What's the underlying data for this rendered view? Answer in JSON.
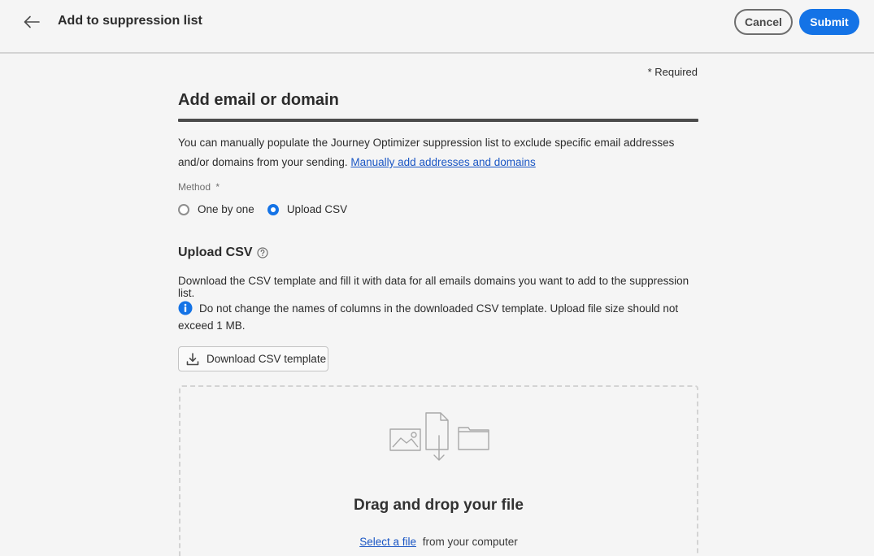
{
  "header": {
    "title": "Add to suppression list",
    "cancel_label": "Cancel",
    "submit_label": "Submit"
  },
  "form": {
    "required_note": "* Required",
    "section_title": "Add email or domain",
    "intro_text": "You can manually populate the Journey Optimizer suppression list to exclude specific email addresses and/or domains from your sending.",
    "intro_link": "Manually add addresses and domains",
    "method_label": "Method",
    "method_required_mark": "*",
    "method_options": [
      {
        "label": "One by one",
        "checked": false
      },
      {
        "label": "Upload CSV",
        "checked": true
      }
    ]
  },
  "upload": {
    "title": "Upload CSV",
    "description": "Download the CSV template and fill it with data for all emails domains you want to add to the suppression list.",
    "info": "Do not change the names of columns in the downloaded CSV template. Upload file size should not exceed 1 MB.",
    "download_label": "Download CSV template",
    "dropzone_title": "Drag and drop your file",
    "select_link": "Select a file",
    "select_suffix": "from your computer"
  },
  "colors": {
    "accent": "#1473e6",
    "link": "#1a56c4",
    "background": "#f5f5f5"
  },
  "icons": {
    "back": "arrow-left-icon",
    "help": "help-circle-icon",
    "info": "info-circle-icon",
    "download": "download-icon"
  }
}
